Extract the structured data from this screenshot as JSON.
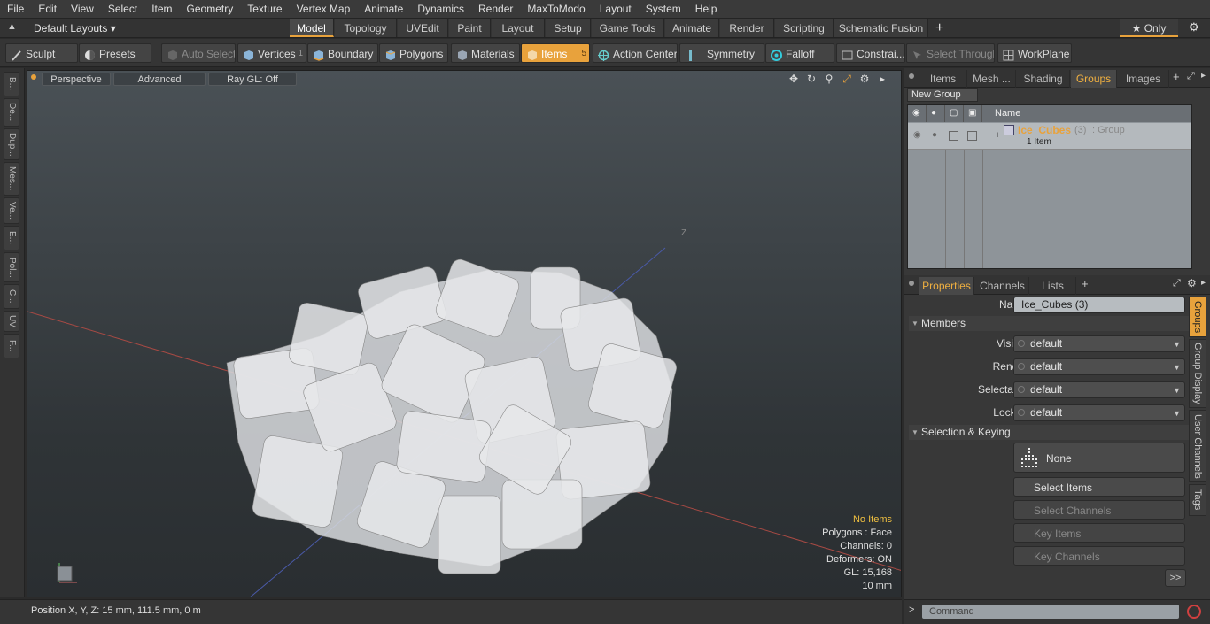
{
  "menu": [
    "File",
    "Edit",
    "View",
    "Select",
    "Item",
    "Geometry",
    "Texture",
    "Vertex Map",
    "Animate",
    "Dynamics",
    "Render",
    "MaxToModo",
    "Layout",
    "System",
    "Help"
  ],
  "layouts_label": "Default Layouts ▾",
  "mode_tabs": [
    "Model",
    "Topology",
    "UVEdit",
    "Paint",
    "Layout",
    "Setup",
    "Game Tools",
    "Animate",
    "Render",
    "Scripting",
    "Schematic Fusion"
  ],
  "plus": "+",
  "only_label": "★ Only",
  "toolbar": {
    "sculpt": "Sculpt",
    "presets": "Presets",
    "auto_select": "Auto Select",
    "vertices": "Vertices",
    "vertices_count": "1",
    "boundary": "Boundary",
    "polygons": "Polygons",
    "materials": "Materials",
    "items": "Items",
    "items_count": "5",
    "action_center": "Action Center",
    "symmetry": "Symmetry",
    "falloff": "Falloff",
    "constraints": "Constrai...",
    "select_through": "Select Through",
    "workplane": "WorkPlane"
  },
  "left_tabs": [
    "B...",
    "De...",
    "Dup...",
    "Mes...",
    "Ve...",
    "E...",
    "Pol...",
    "C...",
    "UV",
    "F..."
  ],
  "viewport": {
    "perspective": "Perspective",
    "advanced": "Advanced",
    "raygl": "Ray GL: Off",
    "axis_z": "Z",
    "info": {
      "no_items": "No Items",
      "polygons": "Polygons : Face",
      "channels": "Channels: 0",
      "deformers": "Deformers: ON",
      "gl": "GL: 15,168",
      "scale": "10 mm"
    }
  },
  "status": "Position X, Y, Z:  15 mm, 111.5 mm, 0 m",
  "panel_tabs": [
    "Items",
    "Mesh ...",
    "Shading",
    "Groups",
    "Images"
  ],
  "new_group": "New Group",
  "list_header": "Name",
  "group": {
    "name": "Ice_Cubes",
    "count": "(3)",
    "type": ": Group",
    "sub": "1 Item"
  },
  "prop_tabs": [
    "Properties",
    "Channels",
    "Lists"
  ],
  "props": {
    "name_label": "Name",
    "name_value": "Ice_Cubes (3)",
    "members": "Members",
    "visible_label": "Visible",
    "render_label": "Render",
    "selectable_label": "Selectable",
    "locked_label": "Locked",
    "default": "default",
    "sel_keying": "Selection & Keying",
    "none": "None",
    "select_items": "Select Items",
    "select_channels": "Select Channels",
    "key_items": "Key Items",
    "key_channels": "Key Channels",
    "more": ">>"
  },
  "right_vtabs": [
    "Groups",
    "Group Display",
    "User Channels",
    "Tags"
  ],
  "command_placeholder": "Command",
  "colors": {
    "accent": "#e8a23c",
    "group_name": "#e8a23c"
  }
}
